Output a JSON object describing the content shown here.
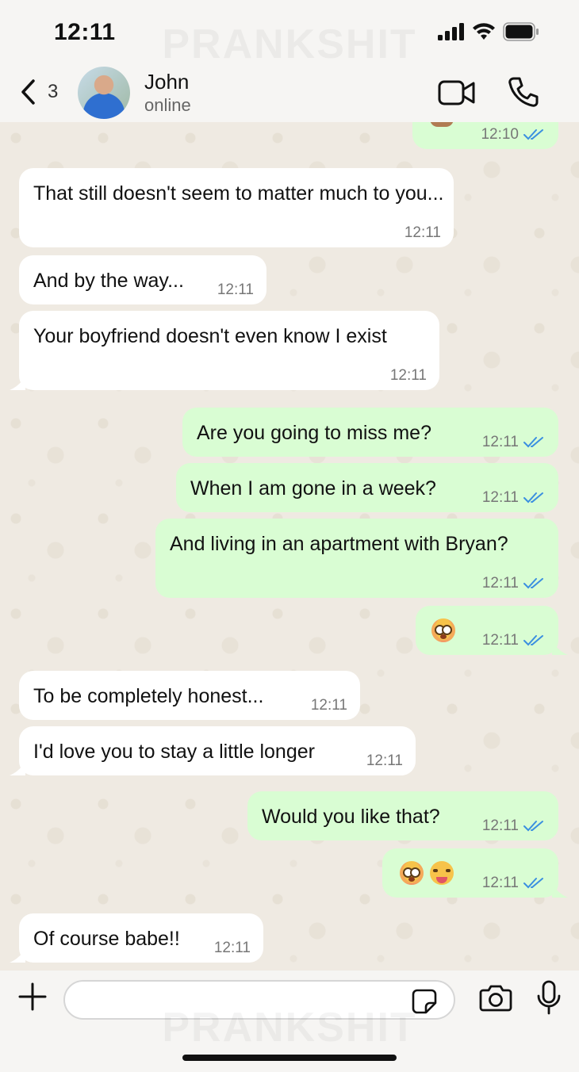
{
  "status_bar": {
    "time": "12:11"
  },
  "watermark": "PRANKSHIT",
  "header": {
    "back_count": "3",
    "contact_name": "John",
    "contact_status": "online"
  },
  "messages": [
    {
      "dir": "out",
      "emoji": "monkey",
      "time": "12:10"
    },
    {
      "dir": "in",
      "text": "That still doesn't seem to matter much to you...",
      "time": "12:11"
    },
    {
      "dir": "in",
      "text": "And by the way...",
      "time": "12:11"
    },
    {
      "dir": "in",
      "text": "Your boyfriend doesn't even know I exist",
      "time": "12:11"
    },
    {
      "dir": "out",
      "text": "Are you going to miss me?",
      "time": "12:11"
    },
    {
      "dir": "out",
      "text": "When I am gone in a week?",
      "time": "12:11"
    },
    {
      "dir": "out",
      "text": "And living in an apartment with Bryan?",
      "time": "12:11"
    },
    {
      "dir": "out",
      "emoji": "flushed",
      "time": "12:11"
    },
    {
      "dir": "in",
      "text": "To be completely honest...",
      "time": "12:11"
    },
    {
      "dir": "in",
      "text": "I'd love you to stay a little longer",
      "time": "12:11"
    },
    {
      "dir": "out",
      "text": "Would you like that?",
      "time": "12:11"
    },
    {
      "dir": "out",
      "emoji": "flushed tongue",
      "time": "12:11"
    },
    {
      "dir": "in",
      "text": "Of course babe!!",
      "time": "12:11"
    }
  ],
  "input": {
    "placeholder": ""
  },
  "colors": {
    "incoming": "#ffffff",
    "outgoing": "#d9fdd3",
    "read_check": "#3b8fe0"
  }
}
